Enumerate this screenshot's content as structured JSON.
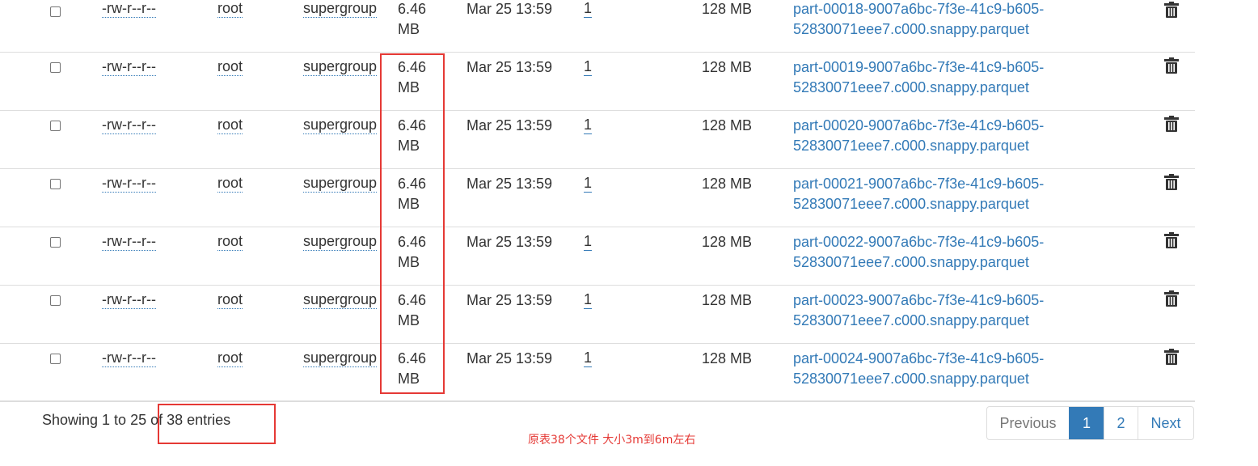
{
  "rows": [
    {
      "perm": "-rw-r--r--",
      "owner": "root",
      "group": "supergroup",
      "size": "6.46 MB",
      "date": "Mar 25 13:59",
      "replication": "1",
      "block_size": "128 MB",
      "name": "part-00018-9007a6bc-7f3e-41c9-b605-52830071eee7.c000.snappy.parquet"
    },
    {
      "perm": "-rw-r--r--",
      "owner": "root",
      "group": "supergroup",
      "size": "6.46 MB",
      "date": "Mar 25 13:59",
      "replication": "1",
      "block_size": "128 MB",
      "name": "part-00019-9007a6bc-7f3e-41c9-b605-52830071eee7.c000.snappy.parquet"
    },
    {
      "perm": "-rw-r--r--",
      "owner": "root",
      "group": "supergroup",
      "size": "6.46 MB",
      "date": "Mar 25 13:59",
      "replication": "1",
      "block_size": "128 MB",
      "name": "part-00020-9007a6bc-7f3e-41c9-b605-52830071eee7.c000.snappy.parquet"
    },
    {
      "perm": "-rw-r--r--",
      "owner": "root",
      "group": "supergroup",
      "size": "6.46 MB",
      "date": "Mar 25 13:59",
      "replication": "1",
      "block_size": "128 MB",
      "name": "part-00021-9007a6bc-7f3e-41c9-b605-52830071eee7.c000.snappy.parquet"
    },
    {
      "perm": "-rw-r--r--",
      "owner": "root",
      "group": "supergroup",
      "size": "6.46 MB",
      "date": "Mar 25 13:59",
      "replication": "1",
      "block_size": "128 MB",
      "name": "part-00022-9007a6bc-7f3e-41c9-b605-52830071eee7.c000.snappy.parquet"
    },
    {
      "perm": "-rw-r--r--",
      "owner": "root",
      "group": "supergroup",
      "size": "6.46 MB",
      "date": "Mar 25 13:59",
      "replication": "1",
      "block_size": "128 MB",
      "name": "part-00023-9007a6bc-7f3e-41c9-b605-52830071eee7.c000.snappy.parquet"
    },
    {
      "perm": "-rw-r--r--",
      "owner": "root",
      "group": "supergroup",
      "size": "6.46 MB",
      "date": "Mar 25 13:59",
      "replication": "1",
      "block_size": "128 MB",
      "name": "part-00024-9007a6bc-7f3e-41c9-b605-52830071eee7.c000.snappy.parquet"
    }
  ],
  "footer": {
    "info": "Showing 1 to 25 of 38 entries",
    "annotation": "原表38个文件  大小3m到6m左右"
  },
  "pagination": {
    "previous": "Previous",
    "page1": "1",
    "page2": "2",
    "next": "Next"
  },
  "colors": {
    "link": "#337ab7",
    "highlight": "#e53935",
    "active_page": "#337ab7"
  },
  "icons": {
    "delete": "trash-icon"
  }
}
